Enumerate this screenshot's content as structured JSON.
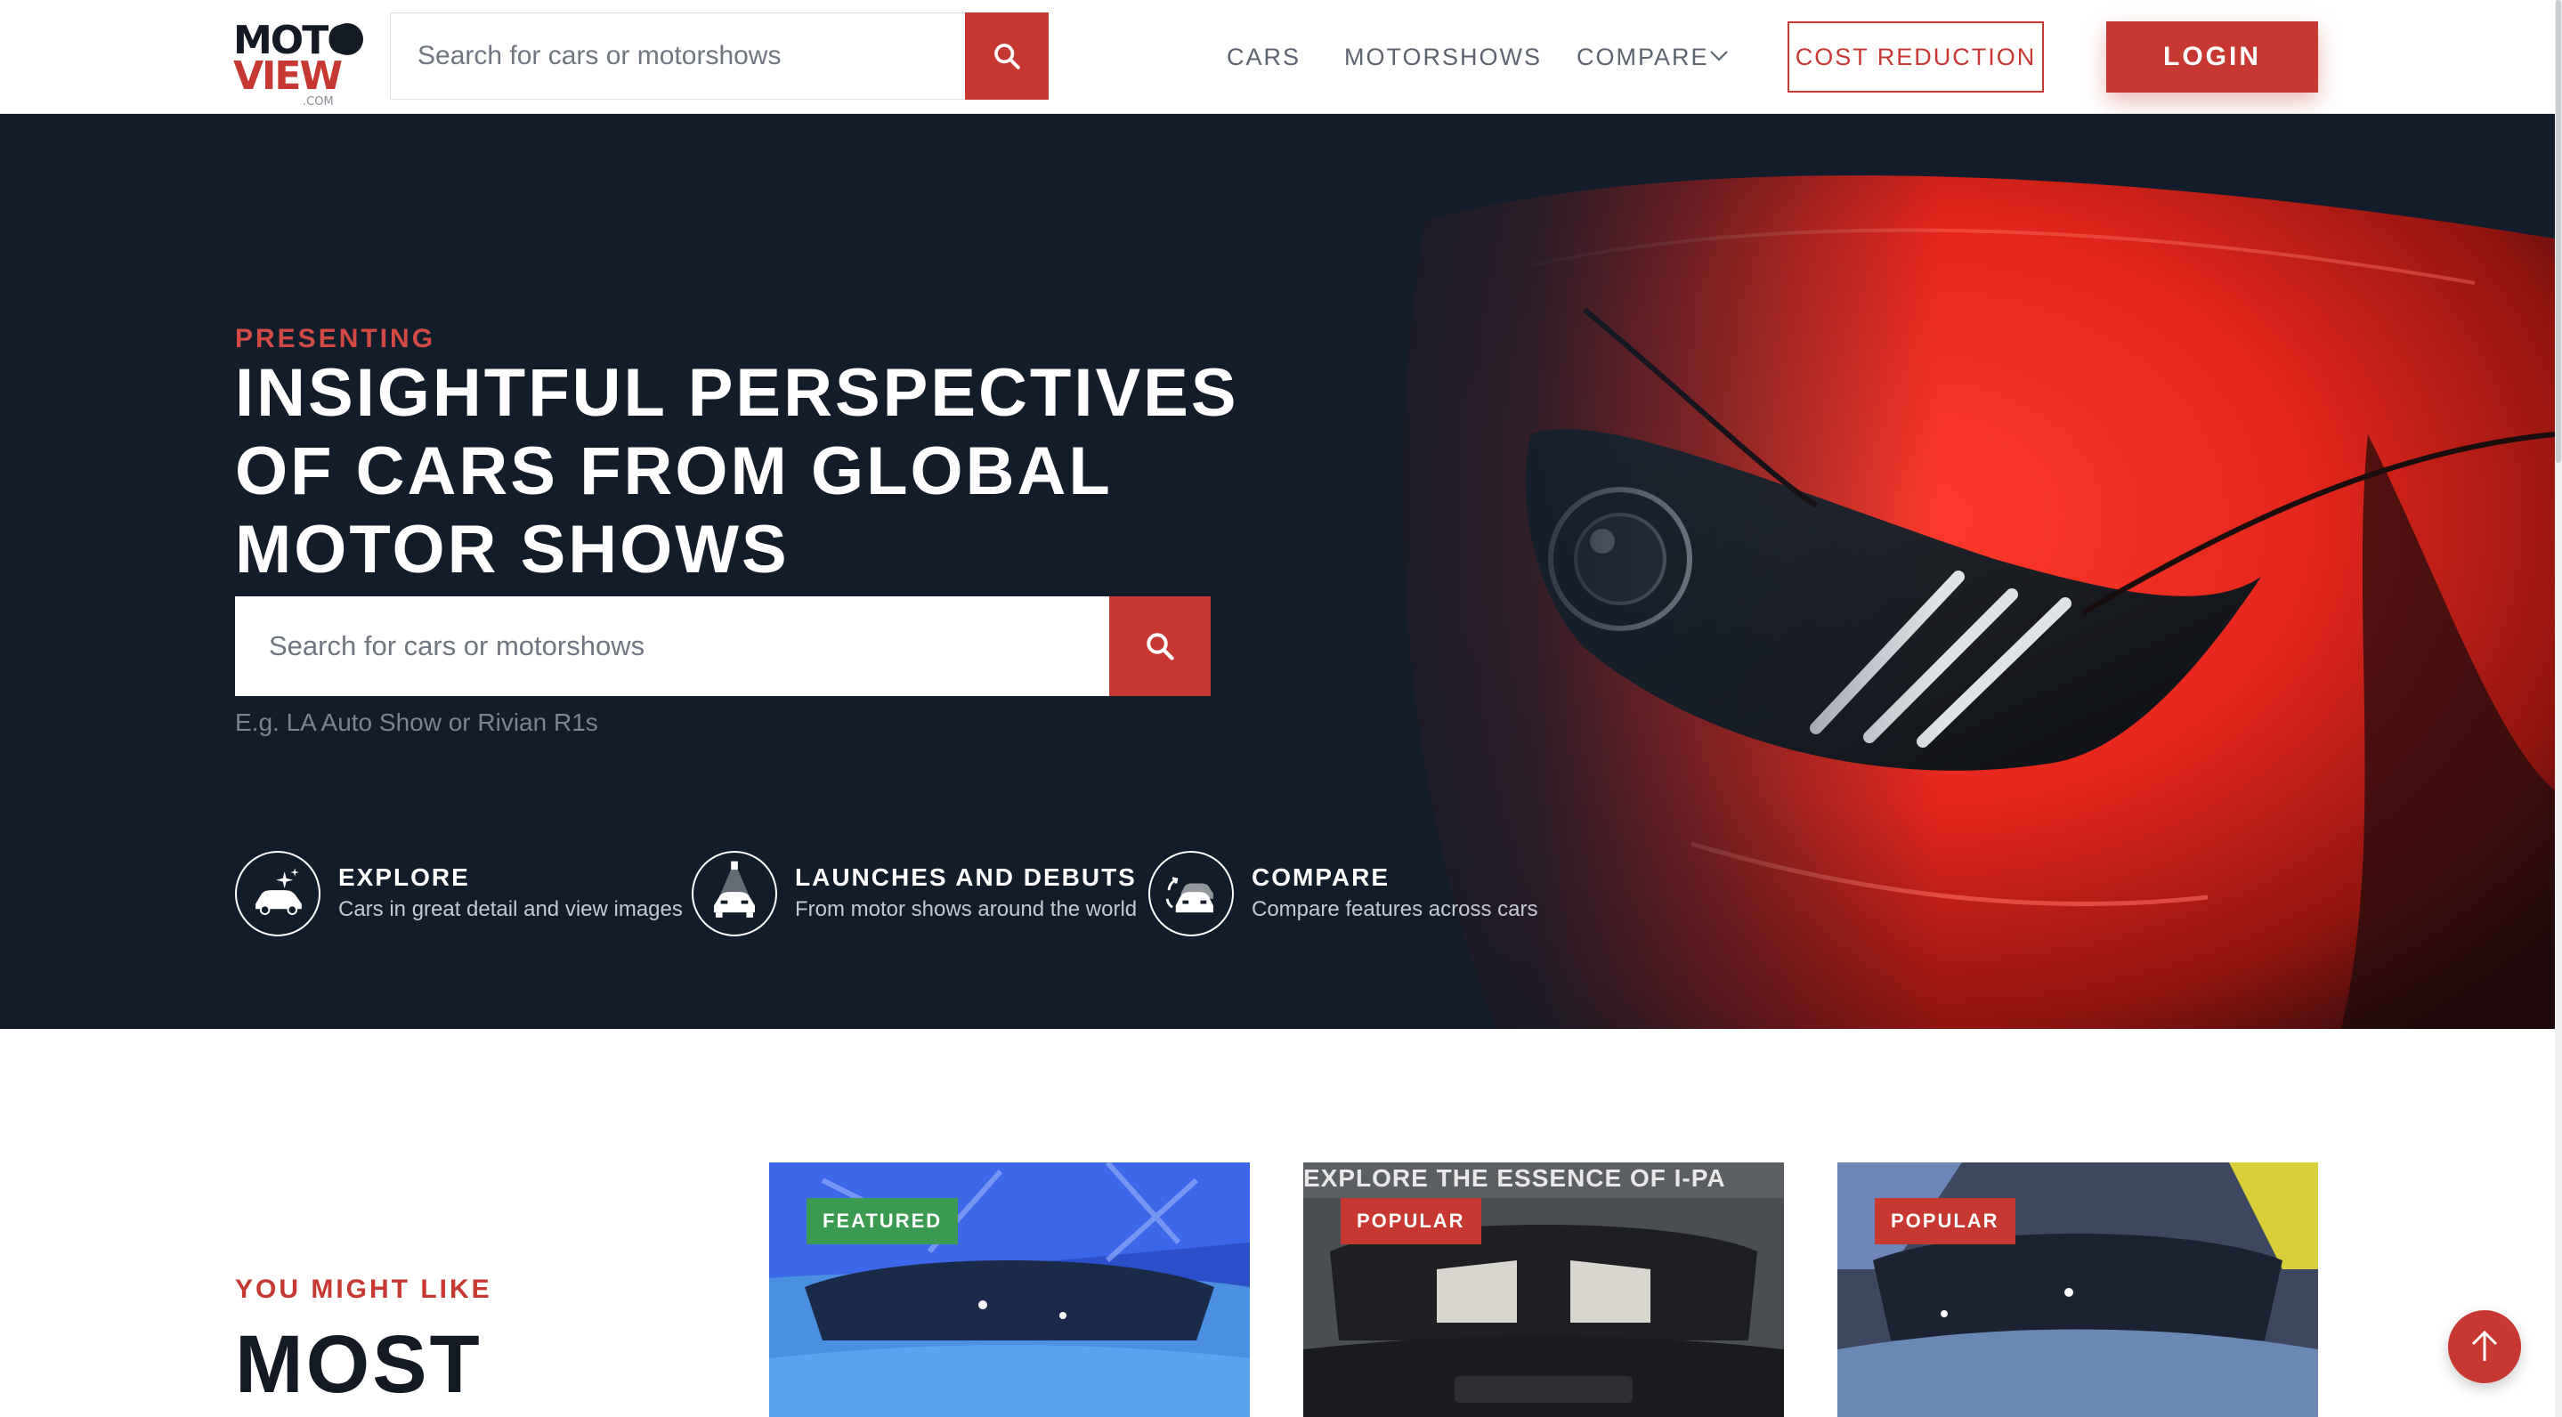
{
  "header": {
    "logo_top": "MOTO",
    "logo_bottom": "VIEW",
    "logo_suffix": ".COM",
    "search_placeholder": "Search for cars or motorshows",
    "nav": {
      "cars": "CARS",
      "motorshows": "MOTORSHOWS",
      "compare": "COMPARE"
    },
    "cost_reduction_label": "COST REDUCTION",
    "login_label": "LOGIN"
  },
  "hero": {
    "kicker": "PRESENTING",
    "title": "INSIGHTFUL PERSPECTIVES OF CARS FROM GLOBAL MOTOR SHOWS",
    "search_placeholder": "Search for cars or motorshows",
    "hint": "E.g. LA Auto Show or Rivian R1s",
    "features": [
      {
        "title": "EXPLORE",
        "desc": "Cars in great detail and view images",
        "icon": "car-sparkle-icon"
      },
      {
        "title": "LAUNCHES AND DEBUTS",
        "desc": "From motor shows around the world",
        "icon": "car-spotlight-icon"
      },
      {
        "title": "COMPARE",
        "desc": "Compare features across cars",
        "icon": "car-compare-icon"
      }
    ]
  },
  "section": {
    "kicker": "YOU MIGHT LIKE",
    "title": "MOST"
  },
  "cards": [
    {
      "badge": "FEATURED",
      "banner": ""
    },
    {
      "badge": "POPULAR",
      "banner": "EXPLORE THE ESSENCE OF I-PA"
    },
    {
      "badge": "POPULAR",
      "banner": ""
    }
  ],
  "colors": {
    "brand_red": "#c73832",
    "hero_bg": "#121c2a",
    "featured_green": "#3a9a52"
  }
}
